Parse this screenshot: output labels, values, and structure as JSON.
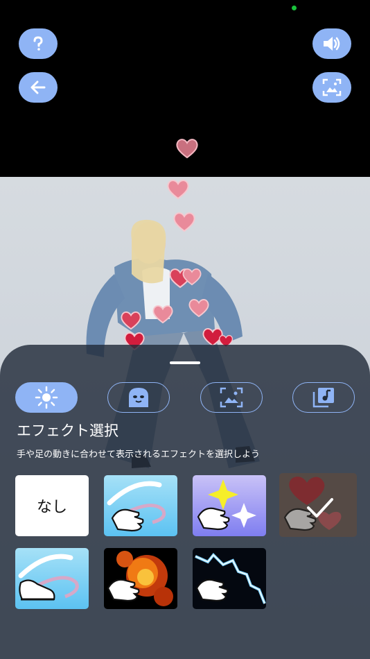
{
  "controls": {
    "help_icon": "question-mark",
    "back_icon": "arrow-left",
    "sound_icon": "speaker",
    "gallery_icon": "image-frame"
  },
  "sheet": {
    "tabs": [
      {
        "name": "effect",
        "icon": "sparkle-icon",
        "active": true
      },
      {
        "name": "mask",
        "icon": "face-mask-icon",
        "active": false
      },
      {
        "name": "background",
        "icon": "image-icon",
        "active": false
      },
      {
        "name": "music",
        "icon": "music-library-icon",
        "active": false
      }
    ],
    "title": "エフェクト選択",
    "subtitle": "手や足の動きに合わせて表示されるエフェクトを選択しよう",
    "effects": [
      {
        "label": "なし",
        "kind": "none"
      },
      {
        "kind": "hand-ribbon"
      },
      {
        "kind": "hand-sparkles"
      },
      {
        "kind": "hand-hearts",
        "selected": true
      },
      {
        "kind": "foot-ribbon"
      },
      {
        "kind": "hand-fire"
      },
      {
        "kind": "hand-lightning"
      }
    ]
  },
  "colors": {
    "accent": "#8fb4f5",
    "sheet": "#222c3a",
    "heart": "#e06a7e"
  }
}
